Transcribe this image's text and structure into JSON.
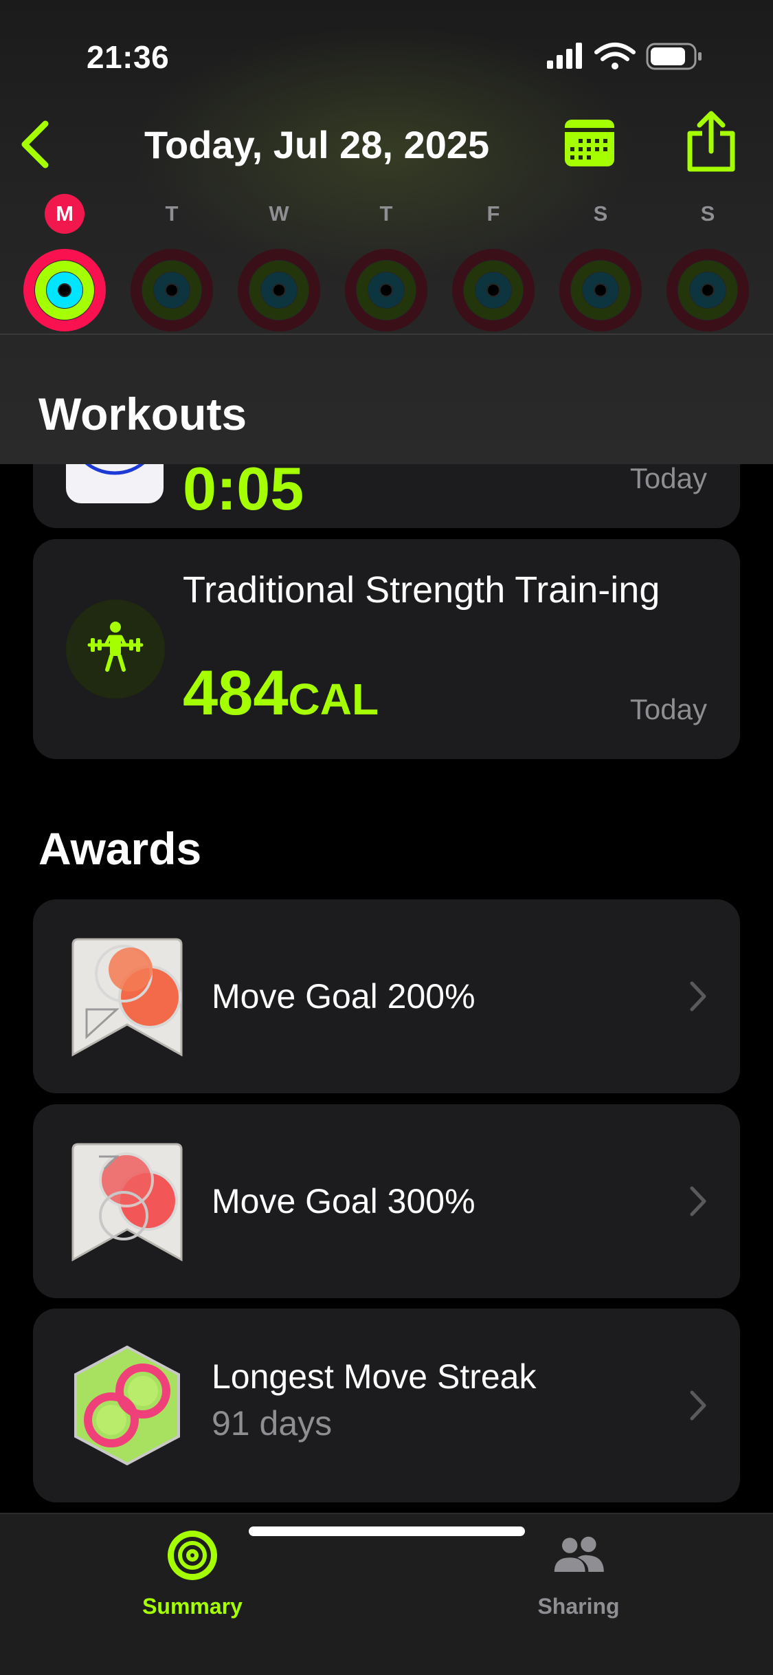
{
  "status_bar": {
    "time": "21:36"
  },
  "nav": {
    "title": "Today, Jul 28, 2025"
  },
  "week": [
    {
      "letter": "M",
      "today": true
    },
    {
      "letter": "T",
      "today": false
    },
    {
      "letter": "W",
      "today": false
    },
    {
      "letter": "T",
      "today": false
    },
    {
      "letter": "F",
      "today": false
    },
    {
      "letter": "S",
      "today": false
    },
    {
      "letter": "S",
      "today": false
    }
  ],
  "workouts": {
    "title": "Workouts",
    "items": [
      {
        "value": "0:05",
        "date": "Today"
      },
      {
        "title": "Traditional Strength Train-ing",
        "value": "484",
        "unit": "CAL",
        "date": "Today"
      }
    ]
  },
  "awards": {
    "title": "Awards",
    "items": [
      {
        "title": "Move Goal 200%",
        "subtitle": ""
      },
      {
        "title": "Move Goal 300%",
        "subtitle": ""
      },
      {
        "title": "Longest Move Streak",
        "subtitle": "91 days"
      }
    ]
  },
  "tabs": [
    {
      "label": "Summary",
      "icon": "activity-rings-icon",
      "active": true
    },
    {
      "label": "Sharing",
      "icon": "people-icon",
      "active": false
    }
  ],
  "colors": {
    "accent": "#a6ff00",
    "move": "#fa114f",
    "exercise": "#a6ff00",
    "stand": "#00f0ff",
    "secondary_text": "#8e8e93"
  }
}
